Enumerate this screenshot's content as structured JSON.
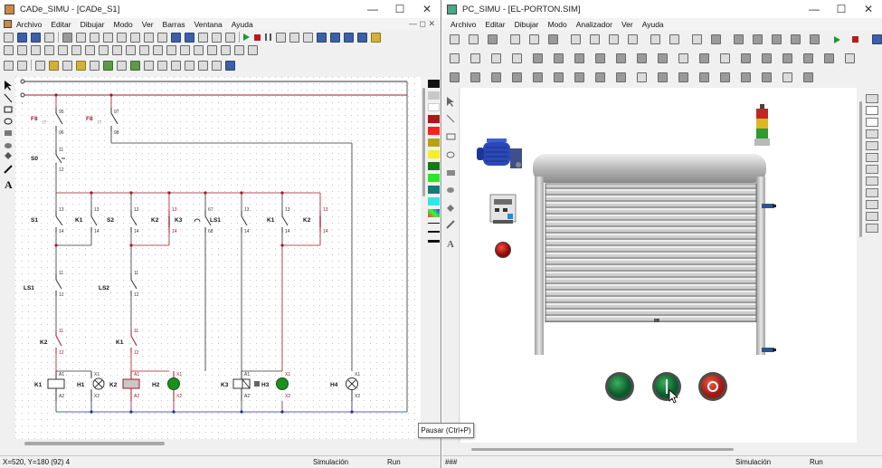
{
  "left": {
    "title": "CADe_SIMU - [CADe_S1]",
    "menu": [
      "Archivo",
      "Editar",
      "Dibujar",
      "Modo",
      "Ver",
      "Barras",
      "Ventana",
      "Ayuda"
    ],
    "status": {
      "coords": "X=520, Y=180 (92) 4",
      "mode": "Simulación",
      "state": "Run"
    },
    "labels": {
      "F8a": "F8",
      "F8b": "F8",
      "S0": "S0",
      "S1": "S1",
      "S2": "S2",
      "LS1": "LS1",
      "LS2": "LS2",
      "K1": "K1",
      "K2": "K2",
      "K3": "K3",
      "H1": "H1",
      "H2": "H2",
      "H3": "H3",
      "H4": "H4",
      "n95": "95",
      "n96": "96",
      "n97": "97",
      "n98": "98",
      "n11": "11",
      "n12": "12",
      "n13": "13",
      "n14": "14",
      "n67": "67",
      "n68": "68",
      "nA1": "A1",
      "nA2": "A2",
      "nX1": "X1",
      "nX2": "X2",
      "IT": "IT"
    }
  },
  "right": {
    "title": "PC_SIMU - [EL-PORTON.SIM]",
    "menu": [
      "Archivo",
      "Editar",
      "Dibujar",
      "Modo",
      "Analizador",
      "Ver",
      "Ayuda"
    ],
    "status": {
      "left": "###",
      "mode": "Simulación",
      "state": "Run"
    }
  },
  "tooltip": "Pausar (Ctrl+P)",
  "colors": {
    "wire_red": "#a0182a",
    "green_lamp": "#1d8f1d",
    "panel_red": "#cc2a22",
    "motor_blue": "#2a49b8"
  }
}
